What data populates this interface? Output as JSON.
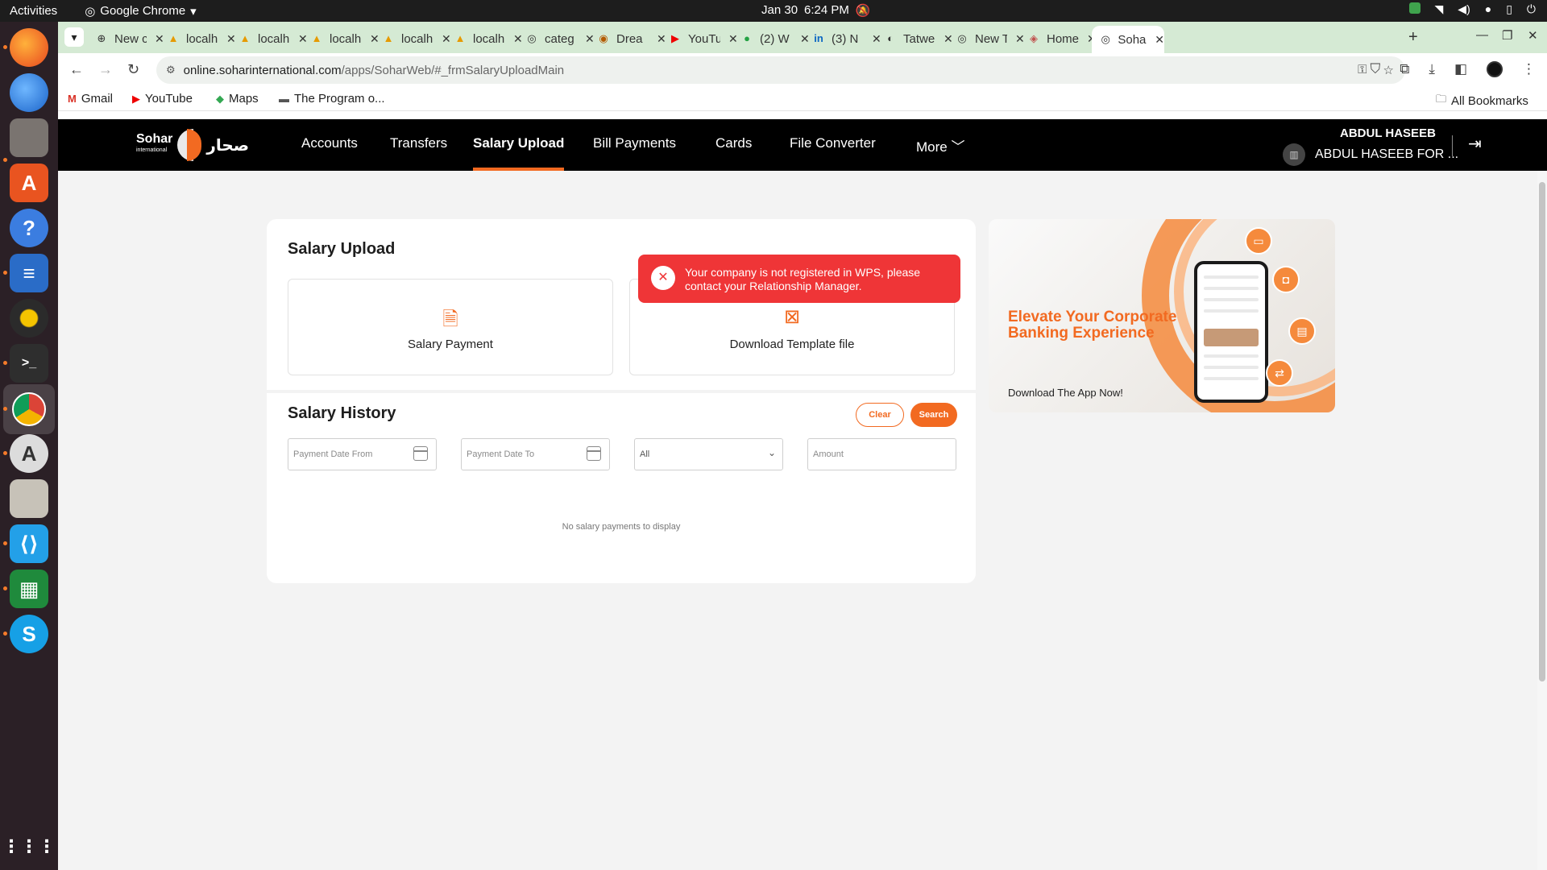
{
  "os": {
    "activities": "Activities",
    "app_name": "Google Chrome",
    "date": "Jan 30",
    "time": "6:24 PM"
  },
  "dock": [
    "firefox-icon",
    "thunderbird-icon",
    "files-icon",
    "app-center-icon",
    "help-icon",
    "writer-icon",
    "rhythmbox-icon",
    "terminal-icon",
    "chrome-icon",
    "software-updater-icon",
    "archive-icon",
    "vscode-icon",
    "calc-icon",
    "skype-icon",
    "app-grid-icon"
  ],
  "browser": {
    "tabs": [
      {
        "title": "New c",
        "icon": "⊕"
      },
      {
        "title": "localh",
        "icon": "▲"
      },
      {
        "title": "localh",
        "icon": "▲"
      },
      {
        "title": "localh",
        "icon": "▲"
      },
      {
        "title": "localh",
        "icon": "▲"
      },
      {
        "title": "localh",
        "icon": "▲"
      },
      {
        "title": "categ",
        "icon": "◎"
      },
      {
        "title": "Drea",
        "icon": "◉"
      },
      {
        "title": "YouTu",
        "icon": "▶"
      },
      {
        "title": "(2) W",
        "icon": "●"
      },
      {
        "title": "(3) N",
        "icon": "in"
      },
      {
        "title": "Tatwe",
        "icon": "◐"
      },
      {
        "title": "New T",
        "icon": "◎"
      },
      {
        "title": "Home",
        "icon": "◈"
      },
      {
        "title": "Sohar",
        "icon": "◎"
      }
    ],
    "url": {
      "host": "online.soharinternational.com",
      "path": "/apps/SoharWeb/#_frmSalaryUploadMain"
    },
    "bookmarks": [
      {
        "label": "Gmail",
        "icon": "M"
      },
      {
        "label": "YouTube",
        "icon": "▶"
      },
      {
        "label": "Maps",
        "icon": "◆"
      },
      {
        "label": "The Program o...",
        "icon": "▬"
      }
    ],
    "all_bookmarks": "All Bookmarks"
  },
  "site": {
    "brand_en": "Sohar",
    "brand_en_sub": "international",
    "brand_ar": "صحار",
    "nav": [
      {
        "label": "Accounts"
      },
      {
        "label": "Transfers"
      },
      {
        "label": "Salary Upload",
        "active": true
      },
      {
        "label": "Bill Payments"
      },
      {
        "label": "Cards"
      },
      {
        "label": "File Converter"
      },
      {
        "label": "More"
      }
    ],
    "user_name": "ABDUL HASEEB",
    "user_company": "ABDUL HASEEB FOR ..."
  },
  "salary_upload": {
    "title": "Salary Upload",
    "tiles": [
      {
        "label": "Salary Payment",
        "icon": "document-upload-icon"
      },
      {
        "label": "Download Template file",
        "icon": "excel-download-icon"
      }
    ]
  },
  "toast": {
    "message": "Your company is not registered in WPS, please contact your Relationship Manager."
  },
  "salary_history": {
    "title": "Salary History",
    "clear_label": "Clear",
    "search_label": "Search",
    "date_from_placeholder": "Payment Date From",
    "date_to_placeholder": "Payment Date To",
    "status_selected": "All",
    "amount_placeholder": "Amount",
    "empty_message": "No salary payments to display"
  },
  "promo": {
    "headline": "Elevate Your Corporate Banking Experience",
    "subtext": "Download The App Now!"
  },
  "colors": {
    "brand_orange": "#f26a21",
    "error_red": "#ef3537",
    "nav_black": "#000000",
    "tabstrip_green": "#d5ead4"
  }
}
